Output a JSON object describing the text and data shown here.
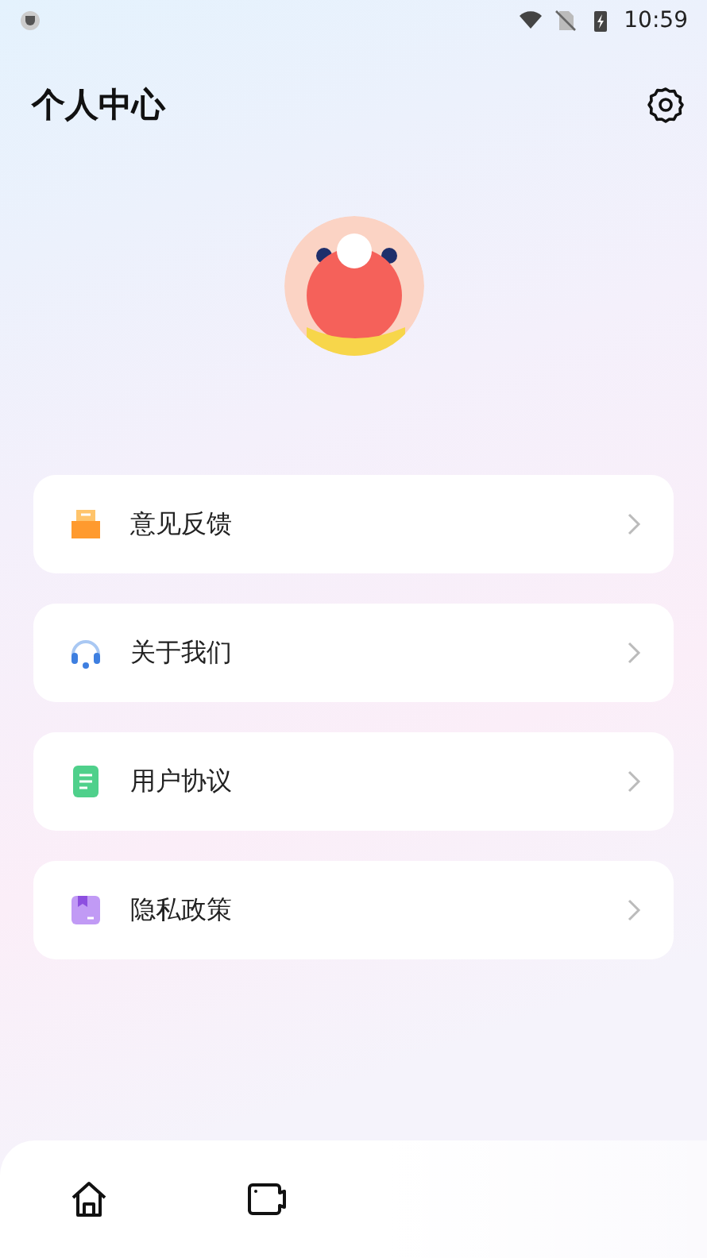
{
  "status_bar": {
    "time": "10:59"
  },
  "header": {
    "title": "个人中心"
  },
  "menu": [
    {
      "kind": "feedback",
      "label": "意见反馈"
    },
    {
      "kind": "about",
      "label": "关于我们"
    },
    {
      "kind": "agreement",
      "label": "用户协议"
    },
    {
      "kind": "privacy",
      "label": "隐私政策"
    }
  ],
  "bottom_nav": [
    {
      "kind": "home"
    },
    {
      "kind": "video"
    }
  ]
}
